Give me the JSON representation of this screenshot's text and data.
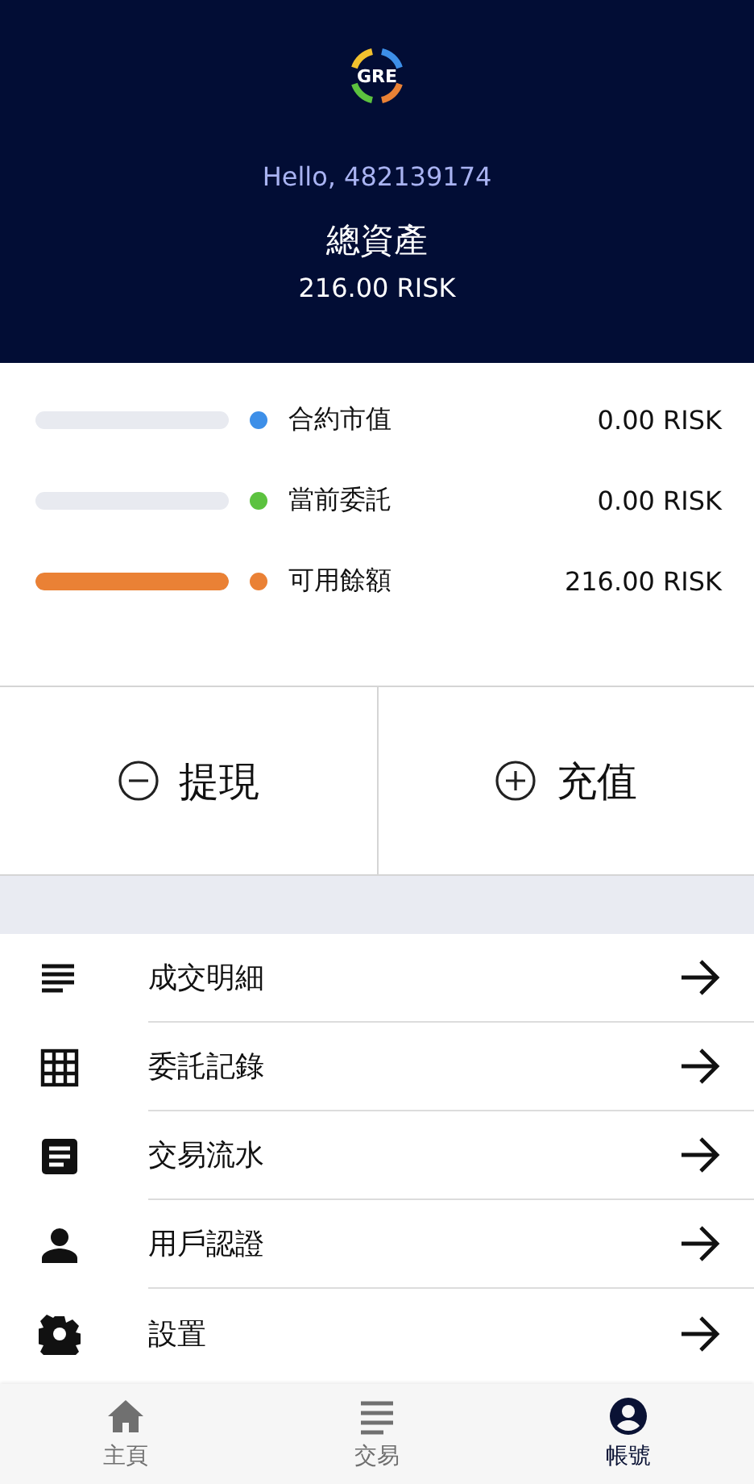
{
  "header": {
    "logo_text": "GRE",
    "greeting": "Hello, 482139174",
    "title": "總資產",
    "total": "216.00 RISK"
  },
  "assets": [
    {
      "label": "合約市值",
      "value": "0.00 RISK",
      "level": 0,
      "color": "#3d8fe8"
    },
    {
      "label": "當前委託",
      "value": "0.00 RISK",
      "level": 0,
      "color": "#5cc23f"
    },
    {
      "label": "可用餘額",
      "value": "216.00 RISK",
      "level": 1,
      "color": "#ea8135"
    }
  ],
  "actions": [
    {
      "kind": "minus",
      "label": "提現"
    },
    {
      "kind": "plus",
      "label": "充值"
    }
  ],
  "menu": [
    {
      "kind": "lines",
      "label": "成交明細"
    },
    {
      "kind": "grid",
      "label": "委託記錄"
    },
    {
      "kind": "document",
      "label": "交易流水"
    },
    {
      "kind": "person",
      "label": "用戶認證"
    },
    {
      "kind": "gear",
      "label": "設置"
    }
  ],
  "nav": [
    {
      "kind": "home",
      "label": "主頁",
      "selected": false
    },
    {
      "kind": "list",
      "label": "交易",
      "selected": false
    },
    {
      "kind": "account",
      "label": "帳號",
      "selected": true
    }
  ]
}
